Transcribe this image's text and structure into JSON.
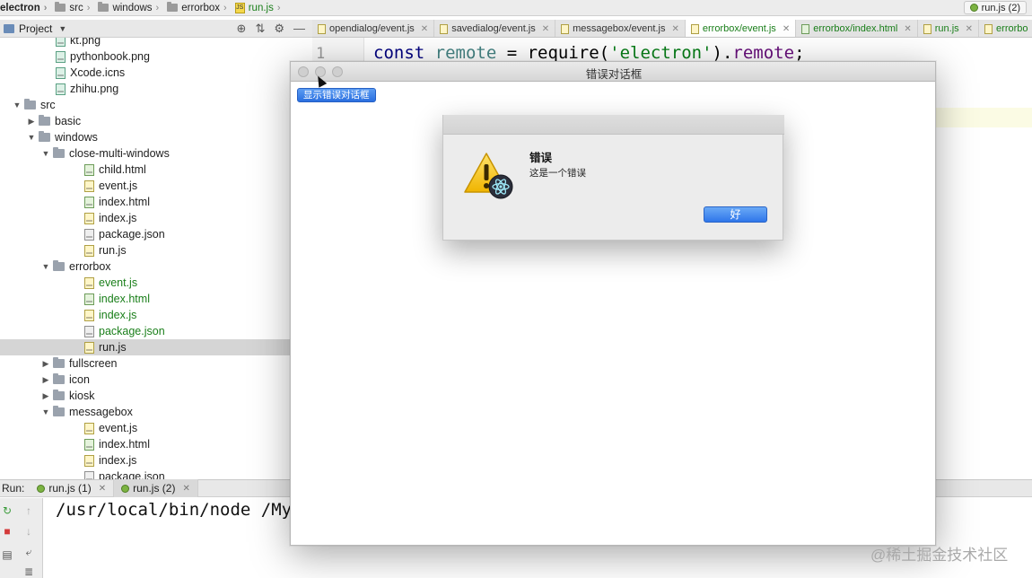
{
  "breadcrumb": {
    "items": [
      "electron",
      "src",
      "windows",
      "errorbox",
      "run.js"
    ],
    "run_config": "run.js (2)"
  },
  "project_panel": {
    "title": "Project",
    "tools": [
      "⊕",
      "⇅",
      "⚙",
      "—"
    ]
  },
  "tree": [
    {
      "label": "kt.png",
      "type": "img",
      "indent": 2
    },
    {
      "label": "pythonbook.png",
      "type": "img",
      "indent": 2
    },
    {
      "label": "Xcode.icns",
      "type": "img",
      "indent": 2
    },
    {
      "label": "zhihu.png",
      "type": "img",
      "indent": 2
    },
    {
      "label": "src",
      "type": "dir-open",
      "indent": 0
    },
    {
      "label": "basic",
      "type": "dir-closed",
      "indent": 1
    },
    {
      "label": "windows",
      "type": "dir-open",
      "indent": 1
    },
    {
      "label": "close-multi-windows",
      "type": "dir-open",
      "indent": 2
    },
    {
      "label": "child.html",
      "type": "html",
      "indent": 4
    },
    {
      "label": "event.js",
      "type": "js",
      "indent": 4
    },
    {
      "label": "index.html",
      "type": "html",
      "indent": 4
    },
    {
      "label": "index.js",
      "type": "js",
      "indent": 4
    },
    {
      "label": "package.json",
      "type": "json",
      "indent": 4
    },
    {
      "label": "run.js",
      "type": "js",
      "indent": 4
    },
    {
      "label": "errorbox",
      "type": "dir-open",
      "indent": 2
    },
    {
      "label": "event.js",
      "type": "js",
      "indent": 4,
      "green": true
    },
    {
      "label": "index.html",
      "type": "html",
      "indent": 4,
      "green": true
    },
    {
      "label": "index.js",
      "type": "js",
      "indent": 4,
      "green": true
    },
    {
      "label": "package.json",
      "type": "json",
      "indent": 4,
      "green": true
    },
    {
      "label": "run.js",
      "type": "js",
      "indent": 4,
      "selected": true
    },
    {
      "label": "fullscreen",
      "type": "dir-closed",
      "indent": 2
    },
    {
      "label": "icon",
      "type": "dir-closed",
      "indent": 2
    },
    {
      "label": "kiosk",
      "type": "dir-closed",
      "indent": 2
    },
    {
      "label": "messagebox",
      "type": "dir-open",
      "indent": 2
    },
    {
      "label": "event.js",
      "type": "js",
      "indent": 4
    },
    {
      "label": "index.html",
      "type": "html",
      "indent": 4
    },
    {
      "label": "index.js",
      "type": "js",
      "indent": 4
    },
    {
      "label": "package.json",
      "type": "json",
      "indent": 4
    }
  ],
  "editor_tabs": [
    {
      "label": "opendialog/event.js",
      "kind": "js"
    },
    {
      "label": "savedialog/event.js",
      "kind": "js"
    },
    {
      "label": "messagebox/event.js",
      "kind": "js"
    },
    {
      "label": "errorbox/event.js",
      "kind": "js",
      "active": true
    },
    {
      "label": "errorbox/index.html",
      "kind": "html",
      "green": true
    },
    {
      "label": "run.js",
      "kind": "js",
      "green": true
    },
    {
      "label": "errorbo",
      "kind": "js",
      "green": true
    }
  ],
  "editor": {
    "line_number": "1",
    "code": {
      "kw": "const",
      "var": "remote",
      "eq": " = require(",
      "str": "'electron'",
      "close": ").",
      "prop": "remote",
      "end": ";"
    }
  },
  "app_window": {
    "title": "错误对话框",
    "show_button": "显示错误对话框"
  },
  "error_dialog": {
    "title": "错误",
    "message": "这是一个错误",
    "ok_button": "好"
  },
  "run_panel": {
    "label": "Run:",
    "tabs": [
      "run.js (1)",
      "run.js (2)"
    ],
    "console_line": "/usr/local/bin/node /MySt"
  },
  "watermark": "@稀土掘金技术社区",
  "colors": {
    "accent_blue": "#2f76ea",
    "vcs_green": "#1a7f1a",
    "selection": "#d5d5d5"
  }
}
